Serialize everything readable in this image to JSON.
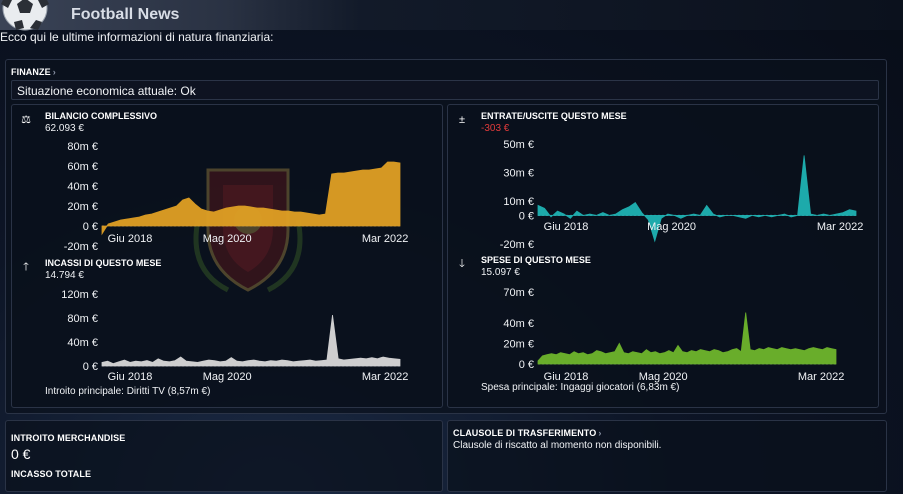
{
  "app": {
    "title": "Football News"
  },
  "intro_text": "Ecco qui le ultime informazioni di natura finanziaria:",
  "finances": {
    "section_title": "FINANZE",
    "status_text": "Situazione economica attuale: Ok",
    "charts": [
      {
        "id": "balance",
        "title": "BILANCIO COMPLESSIVO",
        "value": "62.093 €",
        "icon": "balance-scale-icon",
        "color": "#e0a024",
        "chart_data": {
          "type": "area",
          "y_ticks": [
            "80m €",
            "60m €",
            "40m €",
            "20m €",
            "0 €",
            "-20m €"
          ],
          "y_tick_values": [
            80,
            60,
            40,
            20,
            0,
            -20
          ],
          "x_ticks": [
            "Giu 2018",
            "Mag 2020",
            "Mar 2022"
          ],
          "ylim": [
            -20,
            80
          ],
          "y": [
            -8,
            2,
            4,
            6,
            7,
            8,
            9,
            11,
            12,
            14,
            16,
            18,
            20,
            26,
            28,
            22,
            17,
            15,
            14,
            16,
            18,
            19,
            20,
            20,
            19,
            18,
            18,
            17,
            16,
            15,
            15,
            14,
            14,
            13,
            12,
            11,
            12,
            52,
            53,
            53,
            54,
            55,
            56,
            56,
            57,
            58,
            64,
            64,
            63
          ]
        }
      },
      {
        "id": "inout",
        "title": "ENTRATE/USCITE QUESTO MESE",
        "value": "-303 €",
        "value_negative": true,
        "icon": "plus-minus-icon",
        "color": "#1fb3b3",
        "chart_data": {
          "type": "area",
          "y_ticks": [
            "50m €",
            "30m €",
            "10m €",
            "0 €",
            "-20m €"
          ],
          "y_tick_values": [
            50,
            30,
            10,
            0,
            -20
          ],
          "x_ticks": [
            "Giu 2018",
            "Mag 2020",
            "Mar 2022"
          ],
          "ylim": [
            -20,
            50
          ],
          "y": [
            7,
            5,
            -1,
            3,
            1,
            -2,
            3,
            0,
            1,
            0,
            2,
            0,
            1,
            4,
            6,
            9,
            2,
            -3,
            -18,
            -2,
            1,
            0,
            -2,
            0,
            1,
            0,
            7,
            1,
            -1,
            0,
            0,
            -1,
            -2,
            0,
            -1,
            0,
            -1,
            0,
            1,
            -1,
            0,
            42,
            1,
            0,
            1,
            0,
            1,
            2,
            4,
            3
          ]
        }
      },
      {
        "id": "income",
        "title": "INCASSI DI QUESTO MESE",
        "value": "14.794 €",
        "icon": "arrow-up-icon",
        "color": "#d9d9d9",
        "caption": "Introito principale: Diritti TV (8,57m €)",
        "chart_data": {
          "type": "area",
          "y_ticks": [
            "120m €",
            "80m €",
            "40m €",
            "0 €"
          ],
          "y_tick_values": [
            120,
            80,
            40,
            0
          ],
          "x_ticks": [
            "Giu 2018",
            "Mag 2020",
            "Mar 2022"
          ],
          "ylim": [
            0,
            120
          ],
          "y": [
            6,
            8,
            4,
            7,
            10,
            6,
            8,
            7,
            9,
            6,
            12,
            8,
            7,
            9,
            15,
            8,
            7,
            6,
            8,
            10,
            9,
            7,
            8,
            14,
            8,
            7,
            9,
            10,
            8,
            7,
            9,
            8,
            10,
            9,
            7,
            8,
            9,
            10,
            8,
            9,
            10,
            85,
            12,
            10,
            11,
            12,
            13,
            12,
            14,
            12,
            15,
            13,
            12,
            11
          ]
        }
      },
      {
        "id": "expenses",
        "title": "SPESE DI QUESTO MESE",
        "value": "15.097 €",
        "icon": "arrow-down-icon",
        "color": "#6fb62c",
        "caption": "Spesa principale: Ingaggi giocatori (6,83m €)",
        "chart_data": {
          "type": "area",
          "y_ticks": [
            "70m €",
            "40m €",
            "20m €",
            "0 €"
          ],
          "y_tick_values": [
            70,
            40,
            20,
            0
          ],
          "x_ticks": [
            "Giu 2018",
            "Mag 2020",
            "Mar 2022"
          ],
          "ylim": [
            0,
            70
          ],
          "y": [
            3,
            8,
            9,
            10,
            9,
            11,
            10,
            9,
            12,
            10,
            11,
            9,
            10,
            13,
            12,
            10,
            11,
            12,
            20,
            11,
            10,
            12,
            11,
            10,
            14,
            11,
            12,
            10,
            11,
            13,
            11,
            18,
            12,
            11,
            13,
            12,
            14,
            13,
            12,
            14,
            13,
            11,
            12,
            14,
            15,
            12,
            50,
            14,
            13,
            15,
            14,
            16,
            15,
            14,
            16,
            15,
            14,
            15,
            14,
            13,
            15,
            16,
            15,
            14,
            16,
            15,
            14
          ]
        }
      }
    ]
  },
  "merchandise": {
    "title": "INTROITO MERCHANDISE",
    "value": "0 €",
    "total_title": "INCASSO TOTALE"
  },
  "transfer_clauses": {
    "title": "CLAUSOLE DI TRASFERIMENTO",
    "text": "Clausole di riscatto al momento non disponibili."
  }
}
